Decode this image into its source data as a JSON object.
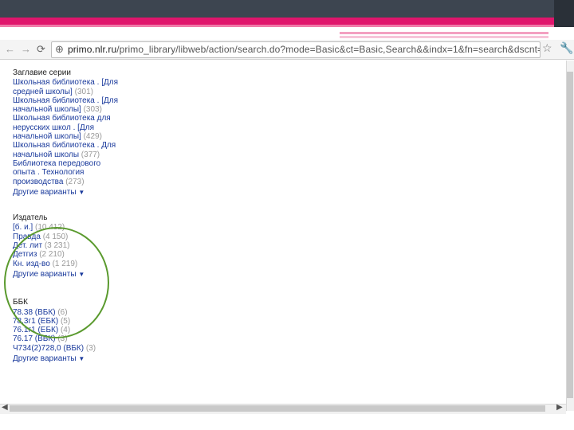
{
  "browser": {
    "back_icon": "back-arrow-icon",
    "forward_icon": "forward-arrow-icon",
    "reload_icon": "reload-icon",
    "url_domain": "primo.nlr.ru",
    "url_path": "/primo_library/libweb/action/search.do?mode=Basic&ct=Basic,Search&&indx=1&fn=search&dscnt=0&vl(1"
  },
  "facets": {
    "series": {
      "title": "Заглавие серии",
      "items": [
        {
          "label": "Школьная библиотека . [Для средней школы]",
          "count": "(301)"
        },
        {
          "label": "Школьная библиотека . [Для начальной школы]",
          "count": "(303)"
        },
        {
          "label": "Школьная библиотека для нерусских школ . [Для начальной школы]",
          "count": "(429)"
        },
        {
          "label": "Школьная библиотека . Для начальной школы",
          "count": "(377)"
        },
        {
          "label": "Библиотека передового опыта . Технология производства",
          "count": "(273)"
        }
      ],
      "more": "Другие варианты"
    },
    "publisher": {
      "title": "Издатель",
      "items": [
        {
          "label": "[б. и.]",
          "count": "(10 412)"
        },
        {
          "label": "Правда",
          "count": "(4 150)"
        },
        {
          "label": "Дет. лит",
          "count": "(3 231)"
        },
        {
          "label": "Детгиз",
          "count": "(2 210)"
        },
        {
          "label": "Кн. изд-во",
          "count": "(1 219)"
        }
      ],
      "more": "Другие варианты"
    },
    "bbk": {
      "title": "ББК",
      "items": [
        {
          "label": "78.38 (ВБК)",
          "count": "(6)"
        },
        {
          "label": "78.3г1 (ЕБК)",
          "count": "(5)"
        },
        {
          "label": "76.1г1 (ЕБК)",
          "count": "(4)"
        },
        {
          "label": "76.17 (ВБК)",
          "count": "(3)"
        },
        {
          "label": "Ч734(2)728,0 (ВБК)",
          "count": "(3)"
        }
      ],
      "more": "Другие варианты"
    }
  }
}
